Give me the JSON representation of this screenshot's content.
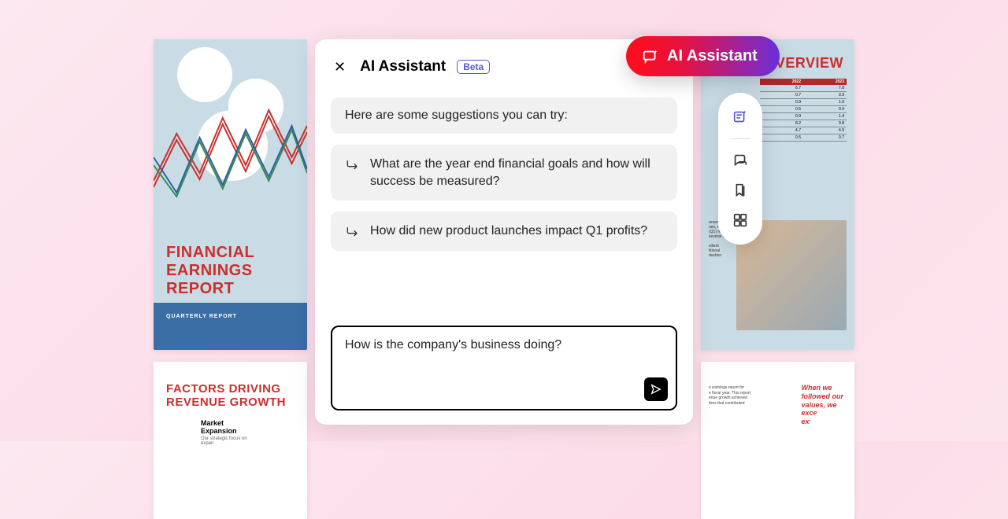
{
  "panel": {
    "title": "AI Assistant",
    "beta_label": "Beta",
    "intro_text": "Here are some suggestions you can try:",
    "suggestions": [
      "What are the year end financial goals and how will success be measured?",
      "How did new product launches impact Q1 profits?"
    ],
    "input_value": "How is the company's business doing?"
  },
  "pill": {
    "label": "AI Assistant"
  },
  "toolbar": {
    "items": [
      "ai-sparkle",
      "comment",
      "bookmark",
      "grid"
    ]
  },
  "bg_docs": {
    "top_left": {
      "title": "FINANCIAL\nEARNINGS\nREPORT",
      "subtitle": "QUARTERLY REPORT"
    },
    "bottom_left": {
      "title": "FACTORS DRIVING\nREVENUE GROWTH",
      "subhead": "Market Expansion",
      "body": "Our strategic focus on expan"
    },
    "top_right": {
      "title": "TH OVERVIEW",
      "table": {
        "headers": [
          "2022",
          "2023"
        ],
        "rows": [
          [
            "6.7",
            "7.8"
          ],
          [
            "0.7",
            "0.9"
          ],
          [
            "0.9",
            "1.0"
          ],
          [
            "0.5",
            "0.9"
          ],
          [
            "0.9",
            "1.4"
          ],
          [
            "8.2",
            "9.8"
          ],
          [
            "4.7",
            "4.9"
          ],
          [
            "0.5",
            "0.7"
          ]
        ]
      },
      "side_text": "revenue for\nues, reflecting\n(Q1) revenue\nseveral key\n\nsilient\nlitional\nduction"
    },
    "bottom_right": {
      "paragraph": "e earnings report for\ne fiscal year. This report\nenue growth achieved\nttors that contributed",
      "callout": "When we\nfollowed our\nvalues, we\nexceeded\nexpectations."
    }
  },
  "colors": {
    "accent_red": "#c9302c",
    "accent_blue": "#3a6ea5",
    "brand_purple": "#5657d6"
  }
}
